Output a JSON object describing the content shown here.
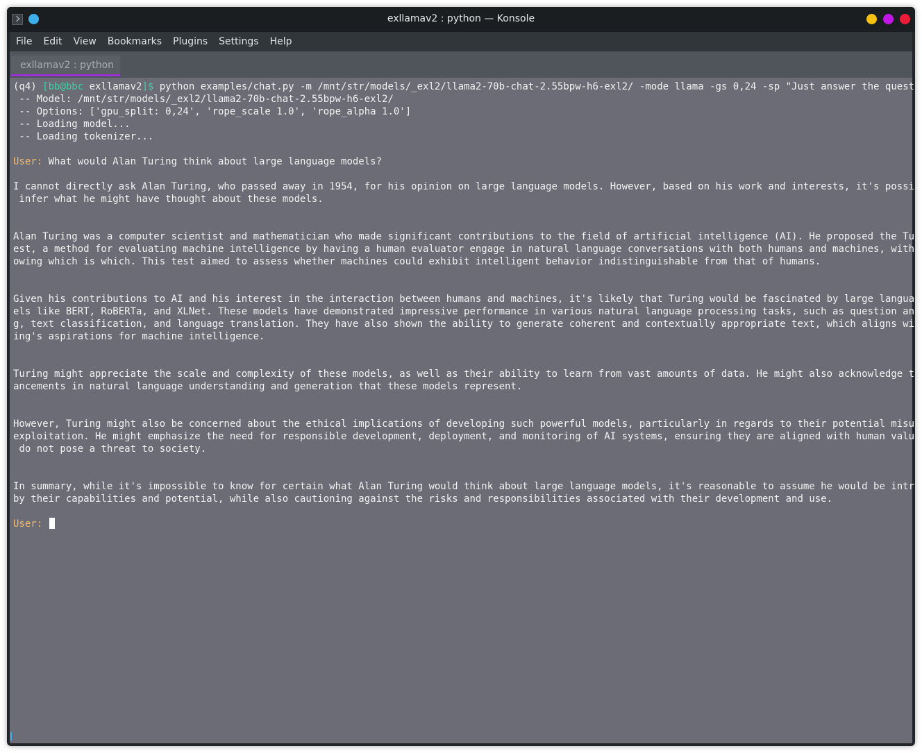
{
  "window": {
    "title": "exllamav2 : python — Konsole"
  },
  "menu": [
    "File",
    "Edit",
    "View",
    "Bookmarks",
    "Plugins",
    "Settings",
    "Help"
  ],
  "tab": {
    "label": "exllamav2 : python"
  },
  "terminal": {
    "prompt": {
      "env": "(q4) ",
      "user_host": "[bb@bbc ",
      "dir": "exllamav2",
      "end": "]$ ",
      "command": "python examples/chat.py -m /mnt/str/models/_exl2/llama2-70b-chat-2.55bpw-h6-exl2/ -mode llama -gs 0,24 -sp \"Just answer the questions.\""
    },
    "info": [
      " -- Model: /mnt/str/models/_exl2/llama2-70b-chat-2.55bpw-h6-exl2/",
      " -- Options: ['gpu_split: 0,24', 'rope_scale 1.0', 'rope_alpha 1.0']",
      " -- Loading model...",
      " -- Loading tokenizer..."
    ],
    "user_label": "User:",
    "question": " What would Alan Turing think about large language models?",
    "response": [
      "I cannot directly ask Alan Turing, who passed away in 1954, for his opinion on large language models. However, based on his work and interests, it's possible to",
      " infer what he might have thought about these models.",
      "Alan Turing was a computer scientist and mathematician who made significant contributions to the field of artificial intelligence (AI). He proposed the Turing T",
      "est, a method for evaluating machine intelligence by having a human evaluator engage in natural language conversations with both humans and machines, without kn",
      "owing which is which. This test aimed to assess whether machines could exhibit intelligent behavior indistinguishable from that of humans.",
      "Given his contributions to AI and his interest in the interaction between humans and machines, it's likely that Turing would be fascinated by large language mod",
      "els like BERT, RoBERTa, and XLNet. These models have demonstrated impressive performance in various natural language processing tasks, such as question answerin",
      "g, text classification, and language translation. They have also shown the ability to generate coherent and contextually appropriate text, which aligns with Tur",
      "ing's aspirations for machine intelligence.",
      "Turing might appreciate the scale and complexity of these models, as well as their ability to learn from vast amounts of data. He might also acknowledge the adv",
      "ancements in natural language understanding and generation that these models represent.",
      "However, Turing might also be concerned about the ethical implications of developing such powerful models, particularly in regards to their potential misuse or",
      "exploitation. He might emphasize the need for responsible development, deployment, and monitoring of AI systems, ensuring they are aligned with human values and",
      " do not pose a threat to society.",
      "In summary, while it's impossible to know for certain what Alan Turing would think about large language models, it's reasonable to assume he would be intrigued",
      "by their capabilities and potential, while also cautioning against the risks and responsibilities associated with their development and use."
    ]
  },
  "colors": {
    "terminal_bg": "#6b6c75",
    "user_label": "#f5b969",
    "prompt_user_host": "#3ed1a8",
    "tab_accent": "#9c31d3",
    "close_button": "#ed1c3a",
    "maximize_button": "#c017e6",
    "minimize_button": "#f5c211",
    "pin_button": "#3daee9"
  }
}
